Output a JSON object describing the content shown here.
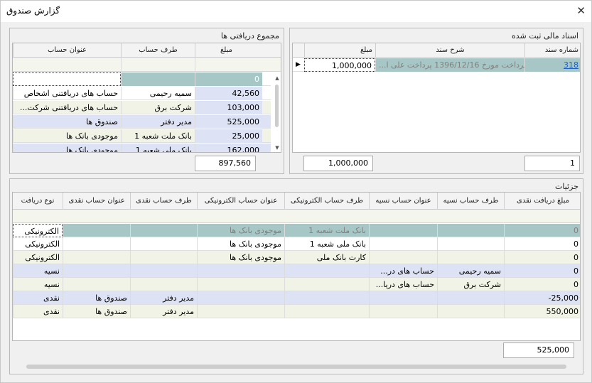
{
  "window": {
    "title": "گزارش صندوق",
    "close_glyph": "✕"
  },
  "left_panel": {
    "title": "اسناد مالی ثبت شده",
    "columns": [
      "شماره سند",
      "شرح سند",
      "مبلغ"
    ],
    "rows": [
      {
        "doc_no": "318",
        "description": "...پرداخت  مورخ 1396/12/16 پرداخت علی ا",
        "amount": "1,000,000"
      }
    ],
    "total_count": "1",
    "total_amount": "1,000,000"
  },
  "right_panel": {
    "title": "مجموع دریافتی ها",
    "columns": [
      "مبلغ",
      "طرف حساب",
      "عنوان حساب"
    ],
    "rows": [
      {
        "amount": "0",
        "party": "",
        "account": ""
      },
      {
        "amount": "42,560",
        "party": "سمیه رحیمی",
        "account": "حساب های دریافتنی اشخاص"
      },
      {
        "amount": "103,000",
        "party": "شرکت برق",
        "account": "...حساب های دریافتنی شرکت"
      },
      {
        "amount": "525,000",
        "party": "مدیر دفتر",
        "account": "صندوق ها"
      },
      {
        "amount": "25,000",
        "party": "بانک ملت شعبه 1",
        "account": "موجودی بانک ها"
      },
      {
        "amount": "162,000",
        "party": "بانک ملی شعبه 1",
        "account": "موجودی بانک ها"
      }
    ],
    "total": "897,560"
  },
  "details": {
    "title": "جزئیات",
    "columns": [
      "مبلغ دریافت نقدی",
      "طرف حساب نسیه",
      "عنوان حساب نسیه",
      "طرف حساب الکترونیکی",
      "عنوان حساب الکترونیکی",
      "طرف حساب نقدی",
      "عنوان حساب نقدی",
      "نوع دریافت"
    ],
    "rows": [
      {
        "cash": "0",
        "credit_party": "",
        "credit_account": "",
        "e_party": "بانک ملت شعبه 1",
        "e_account": "موجودی بانک ها",
        "cash_party": "",
        "cash_account": "",
        "type": "الکترونیکی"
      },
      {
        "cash": "0",
        "credit_party": "",
        "credit_account": "",
        "e_party": "بانک ملی شعبه 1",
        "e_account": "موجودی بانک ها",
        "cash_party": "",
        "cash_account": "",
        "type": "الکترونیکی"
      },
      {
        "cash": "0",
        "credit_party": "",
        "credit_account": "",
        "e_party": "کارت بانک ملی",
        "e_account": "موجودی بانک ها",
        "cash_party": "",
        "cash_account": "",
        "type": "الکترونیکی"
      },
      {
        "cash": "0",
        "credit_party": "سمیه رحیمی",
        "credit_account": "...حساب های در",
        "e_party": "",
        "e_account": "",
        "cash_party": "",
        "cash_account": "",
        "type": "نسیه"
      },
      {
        "cash": "0",
        "credit_party": "شرکت برق",
        "credit_account": "...حساب های دریا",
        "e_party": "",
        "e_account": "",
        "cash_party": "",
        "cash_account": "",
        "type": "نسیه"
      },
      {
        "cash": "-25,000",
        "credit_party": "",
        "credit_account": "",
        "e_party": "",
        "e_account": "",
        "cash_party": "مدیر دفتر",
        "cash_account": "صندوق ها",
        "type": "نقدی"
      },
      {
        "cash": "550,000",
        "credit_party": "",
        "credit_account": "",
        "e_party": "",
        "e_account": "",
        "cash_party": "مدیر دفتر",
        "cash_account": "صندوق ها",
        "type": "نقدی"
      }
    ],
    "total": "525,000"
  },
  "icons": {
    "row_indicator": "▶",
    "scroll_up": "▲",
    "scroll_down": "▼"
  },
  "colors": {
    "selected_row": "#a7c7c7",
    "alt_row": "#dde3f5",
    "plain_row": "#ffffff",
    "light_row": "#f1f3e6",
    "link": "#1f5fbf"
  }
}
